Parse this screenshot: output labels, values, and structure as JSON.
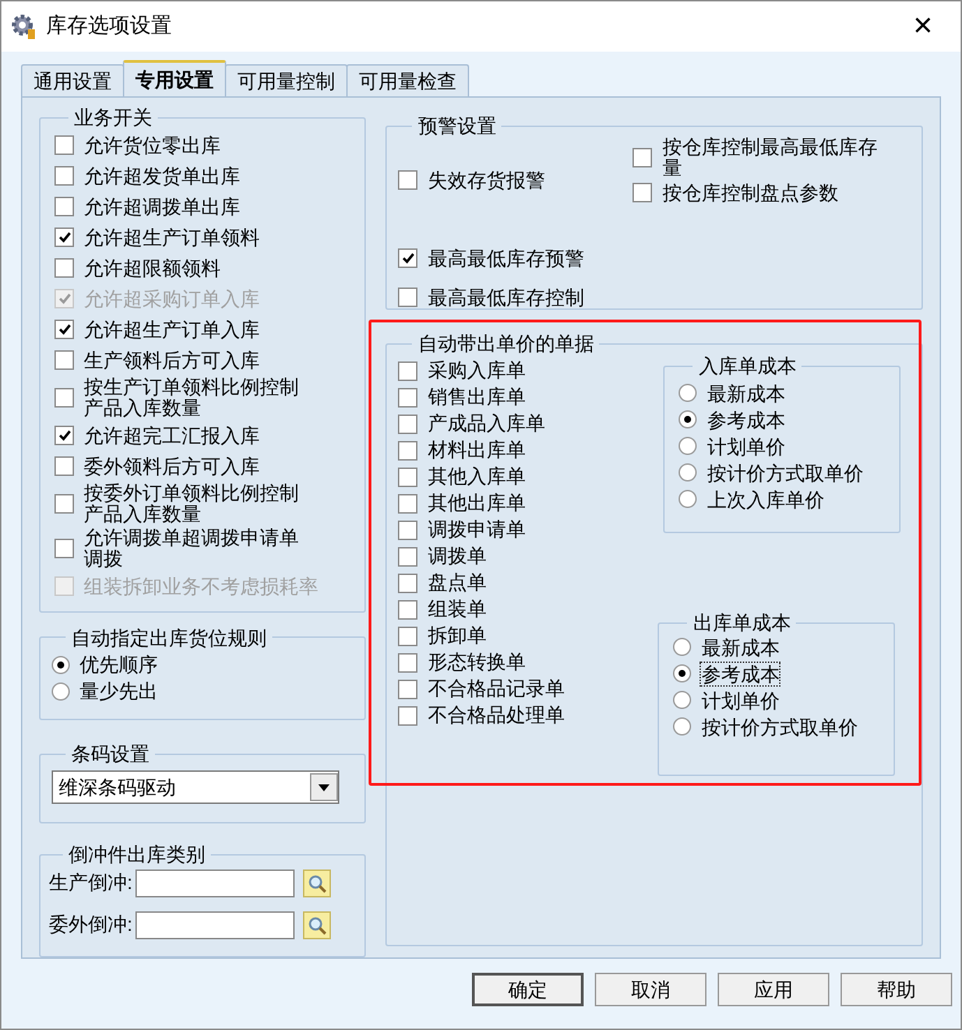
{
  "window": {
    "title": "库存选项设置",
    "close": "×"
  },
  "tabs": [
    {
      "label": "通用设置",
      "selected": false
    },
    {
      "label": "专用设置",
      "selected": true
    },
    {
      "label": "可用量控制",
      "selected": false
    },
    {
      "label": "可用量检查",
      "selected": false
    }
  ],
  "business": {
    "title": "业务开关",
    "items": [
      {
        "label": "允许货位零出库",
        "checked": false,
        "disabled": false
      },
      {
        "label": "允许超发货单出库",
        "checked": false,
        "disabled": false
      },
      {
        "label": "允许超调拨单出库",
        "checked": false,
        "disabled": false
      },
      {
        "label": "允许超生产订单领料",
        "checked": true,
        "disabled": false
      },
      {
        "label": "允许超限额领料",
        "checked": false,
        "disabled": false
      },
      {
        "label": "允许超采购订单入库",
        "checked": true,
        "disabled": true
      },
      {
        "label": "允许超生产订单入库",
        "checked": true,
        "disabled": false
      },
      {
        "label": "生产领料后方可入库",
        "checked": false,
        "disabled": false
      },
      {
        "label": "按生产订单领料比例控制产品入库数量",
        "checked": false,
        "disabled": false
      },
      {
        "label": "允许超完工汇报入库",
        "checked": true,
        "disabled": false
      },
      {
        "label": "委外领料后方可入库",
        "checked": false,
        "disabled": false
      },
      {
        "label": "按委外订单领料比例控制产品入库数量",
        "checked": false,
        "disabled": false
      },
      {
        "label": "允许调拨单超调拨申请单调拨",
        "checked": false,
        "disabled": false
      },
      {
        "label": "组装拆卸业务不考虑损耗率",
        "checked": false,
        "disabled": true
      }
    ]
  },
  "location_rule": {
    "title": "自动指定出库货位规则",
    "options": [
      {
        "label": "优先顺序",
        "selected": true
      },
      {
        "label": "量少先出",
        "selected": false
      }
    ]
  },
  "barcode": {
    "title": "条码设置",
    "value": "维深条码驱动"
  },
  "backflush": {
    "title": "倒冲件出库类别",
    "fields": [
      {
        "label": "生产倒冲:"
      },
      {
        "label": "委外倒冲:"
      }
    ]
  },
  "warning": {
    "title": "预警设置",
    "top_left": [
      {
        "label": "失效存货报警",
        "checked": false
      }
    ],
    "top_right": [
      {
        "label": "按仓库控制最高最低库存量",
        "checked": false
      },
      {
        "label": "按仓库控制盘点参数",
        "checked": false
      }
    ],
    "bottom": [
      {
        "label": "最高最低库存预警",
        "checked": true
      },
      {
        "label": "最高最低库存控制",
        "checked": false
      }
    ]
  },
  "auto_price": {
    "title": "自动带出单价的单据",
    "highlighted": true,
    "documents": [
      {
        "label": "采购入库单",
        "checked": false
      },
      {
        "label": "销售出库单",
        "checked": false
      },
      {
        "label": "产成品入库单",
        "checked": false
      },
      {
        "label": "材料出库单",
        "checked": false
      },
      {
        "label": "其他入库单",
        "checked": false
      },
      {
        "label": "其他出库单",
        "checked": false
      },
      {
        "label": "调拨申请单",
        "checked": false
      },
      {
        "label": "调拨单",
        "checked": false
      },
      {
        "label": "盘点单",
        "checked": false
      },
      {
        "label": "组装单",
        "checked": false
      },
      {
        "label": "拆卸单",
        "checked": false
      },
      {
        "label": "形态转换单",
        "checked": false
      },
      {
        "label": "不合格品记录单",
        "checked": false
      },
      {
        "label": "不合格品处理单",
        "checked": false
      }
    ],
    "inbound_cost": {
      "title": "入库单成本",
      "options": [
        {
          "label": "最新成本",
          "selected": false
        },
        {
          "label": "参考成本",
          "selected": true
        },
        {
          "label": "计划单价",
          "selected": false
        },
        {
          "label": "按计价方式取单价",
          "selected": false
        },
        {
          "label": "上次入库单价",
          "selected": false
        }
      ]
    },
    "outbound_cost": {
      "title": "出库单成本",
      "options": [
        {
          "label": "最新成本",
          "selected": false
        },
        {
          "label": "参考成本",
          "selected": true,
          "focused": true
        },
        {
          "label": "计划单价",
          "selected": false
        },
        {
          "label": "按计价方式取单价",
          "selected": false
        }
      ]
    }
  },
  "buttons": [
    {
      "label": "确定",
      "default": true
    },
    {
      "label": "取消",
      "default": false
    },
    {
      "label": "应用",
      "default": false
    },
    {
      "label": "帮助",
      "default": false
    }
  ]
}
